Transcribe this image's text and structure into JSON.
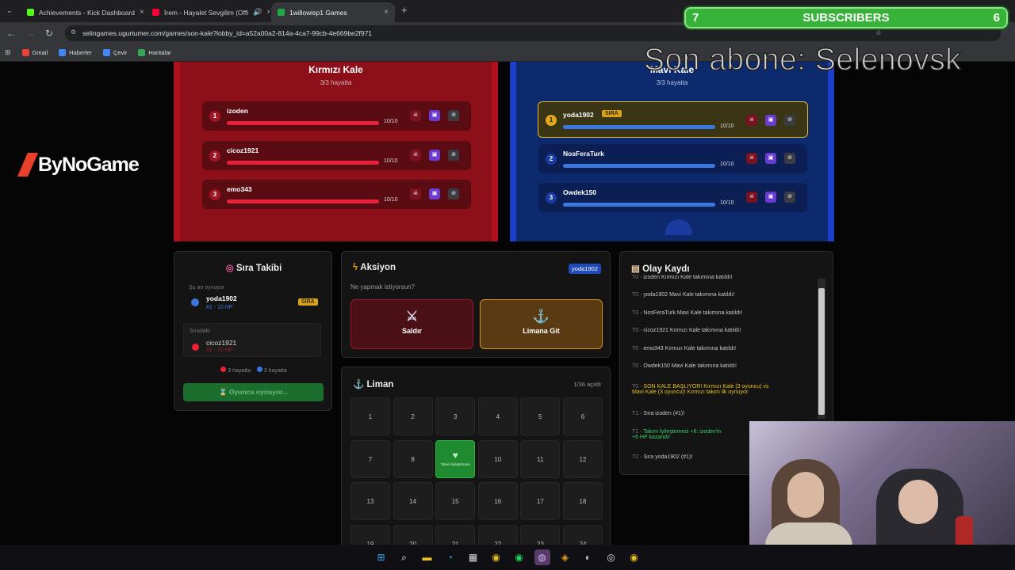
{
  "browser": {
    "tabs": [
      {
        "title": "Achievements - Kick Dashboard",
        "favicon_color": "#53fc18"
      },
      {
        "title": "İrem - Hayalet Sevgilim (Offi",
        "favicon_color": "#ff0033"
      },
      {
        "title": "1willowisp1 Games",
        "favicon_color": "#22aa44"
      }
    ],
    "url": "selingames.ugurtumer.com/games/son-kale?lobby_id=a52a00a2-814a-4ca7-99cb-4e669be2f971",
    "bookmarks": [
      {
        "label": "Gmail",
        "color": "#ea4335"
      },
      {
        "label": "Haberler",
        "color": "#4285f4"
      },
      {
        "label": "Çevir",
        "color": "#4285f4"
      },
      {
        "label": "Haritalar",
        "color": "#34a853"
      }
    ]
  },
  "overlay": {
    "subscribers_left": "7",
    "subscribers_label": "SUBSCRIBERS",
    "subscribers_right": "6",
    "last_sub": "Son abone: Selenovsk",
    "logo_text": "ByNoGame"
  },
  "red_team": {
    "title": "Kırmızı Kale",
    "subtitle": "3/3 hayatta",
    "players": [
      {
        "num": "1",
        "name": "izoden",
        "hp": "10/10",
        "hp_fraction": 1.0
      },
      {
        "num": "2",
        "name": "cicoz1921",
        "hp": "10/10",
        "hp_fraction": 1.0
      },
      {
        "num": "3",
        "name": "emo343",
        "hp": "10/10",
        "hp_fraction": 1.0
      }
    ]
  },
  "blue_team": {
    "title": "Mavi Kale",
    "subtitle": "3/3 hayatta",
    "players": [
      {
        "num": "1",
        "name": "yoda1902",
        "hp": "10/10",
        "hp_fraction": 1.0,
        "tag": "SIRA"
      },
      {
        "num": "2",
        "name": "NosFeraTurk",
        "hp": "10/10",
        "hp_fraction": 1.0
      },
      {
        "num": "3",
        "name": "Owdek150",
        "hp": "10/10",
        "hp_fraction": 1.0
      }
    ]
  },
  "turn_panel": {
    "title": "Sıra Takibi",
    "now_playing_label": "Şu an oynuyor",
    "current_name": "yoda1902",
    "current_sub": "#1 - 10 HP",
    "current_tag": "SIRA",
    "next_label": "Sıradaki",
    "next_name": "cicoz1921",
    "next_sub": "#2 - 10 HP",
    "red_alive": "3 hayatta",
    "blue_alive": "3 hayatta",
    "status_button": "Oyuncu oynuyor..."
  },
  "action_panel": {
    "title": "Aksiyon",
    "player_badge": "yoda1902",
    "question": "Ne yapmak istiyorsun?",
    "attack_label": "Saldır",
    "port_label": "Limana Git"
  },
  "port_panel": {
    "title": "Liman",
    "opened": "1/36 açıldı",
    "cells": [
      "1",
      "2",
      "3",
      "4",
      "5",
      "6",
      "7",
      "8",
      "",
      "10",
      "11",
      "12",
      "13",
      "14",
      "15",
      "16",
      "17",
      "18",
      "19",
      "20",
      "21",
      "22",
      "23",
      "24"
    ],
    "heal_cell_label": "Takım İyileştirmesi"
  },
  "log_panel": {
    "title": "Olay Kaydı",
    "entries": [
      {
        "t": "T0",
        "text": "izoden Kırmızı Kale takımına katıldı!",
        "color": "#c8c8c8"
      },
      {
        "t": "T0",
        "text": "yoda1902 Mavi Kale takımına katıldı!",
        "color": "#c8c8c8"
      },
      {
        "t": "T0",
        "text": "NosFeraTurk Mavi Kale takımına katıldı!",
        "color": "#c8c8c8"
      },
      {
        "t": "T0",
        "text": "cicoz1921 Kırmızı Kale takımına katıldı!",
        "color": "#c8c8c8"
      },
      {
        "t": "T0",
        "text": "emo343 Kırmızı Kale takımına katıldı!",
        "color": "#c8c8c8"
      },
      {
        "t": "T0",
        "text": "Owdek150 Mavi Kale takımına katıldı!",
        "color": "#c8c8c8"
      },
      {
        "t": "T0",
        "text": "SON KALE BAŞLIYOR! Kırmızı Kale (3 oyuncu) vs",
        "text2": "Mavi Kale (3 oyuncu)! Kırmızı takım ilk oynuyor.",
        "color": "#e8c020"
      },
      {
        "t": "T1",
        "text": "Sıra izoden (#1)!",
        "color": "#c8c8c8"
      },
      {
        "t": "T1",
        "text": "Takım İyileştirmesi +6: izoden'in",
        "text2": "+6 HP kazandı!",
        "color": "#3fd06a"
      },
      {
        "t": "T2",
        "text": "Sıra yoda1902 (#1)!",
        "color": "#c8c8c8"
      }
    ]
  }
}
